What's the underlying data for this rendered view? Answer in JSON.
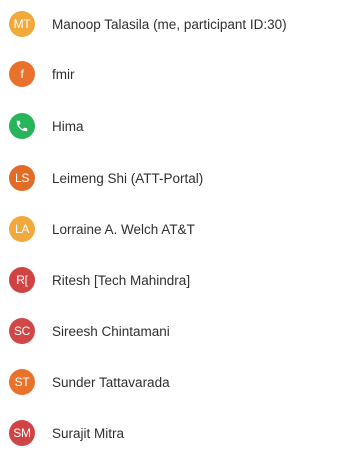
{
  "participants": [
    {
      "initials": "MT",
      "name": "Manoop Talasila (me, participant ID:30)",
      "color": "#f2a93b",
      "icon": null
    },
    {
      "initials": "f",
      "name": "fmir",
      "color": "#e8722c",
      "icon": null
    },
    {
      "initials": "",
      "name": "Hima",
      "color": "#27b45a",
      "icon": "phone-icon"
    },
    {
      "initials": "LS",
      "name": "Leimeng Shi (ATT-Portal)",
      "color": "#e06c28",
      "icon": null
    },
    {
      "initials": "LA",
      "name": "Lorraine A. Welch AT&T",
      "color": "#f2a93b",
      "icon": null
    },
    {
      "initials": "R[",
      "name": "Ritesh [Tech Mahindra]",
      "color": "#d04343",
      "icon": null
    },
    {
      "initials": "SC",
      "name": "Sireesh Chintamani",
      "color": "#cf4747",
      "icon": null
    },
    {
      "initials": "ST",
      "name": "Sunder Tattavarada",
      "color": "#e8722c",
      "icon": null
    },
    {
      "initials": "SM",
      "name": "Surajit Mitra",
      "color": "#d14444",
      "icon": null
    }
  ]
}
